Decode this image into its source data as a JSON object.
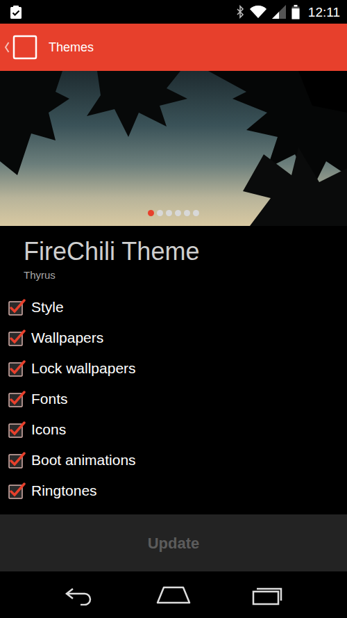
{
  "status_bar": {
    "time": "12:11",
    "wifi_level": 1,
    "signal_level": 0.5,
    "battery_level": 0.9
  },
  "action_bar": {
    "title": "Themes"
  },
  "carousel": {
    "dots": [
      {
        "selected": true
      },
      {
        "selected": false
      },
      {
        "selected": false
      },
      {
        "selected": false
      },
      {
        "selected": false
      },
      {
        "selected": false
      }
    ]
  },
  "theme": {
    "name": "FireChili Theme",
    "author": "Thyrus"
  },
  "components": [
    {
      "label": "Style",
      "checked": true
    },
    {
      "label": "Wallpapers",
      "checked": true
    },
    {
      "label": "Lock wallpapers",
      "checked": true
    },
    {
      "label": "Fonts",
      "checked": true
    },
    {
      "label": "Icons",
      "checked": true
    },
    {
      "label": "Boot animations",
      "checked": true
    },
    {
      "label": "Ringtones",
      "checked": true
    }
  ],
  "update_button": {
    "label": "Update",
    "disabled": true
  }
}
